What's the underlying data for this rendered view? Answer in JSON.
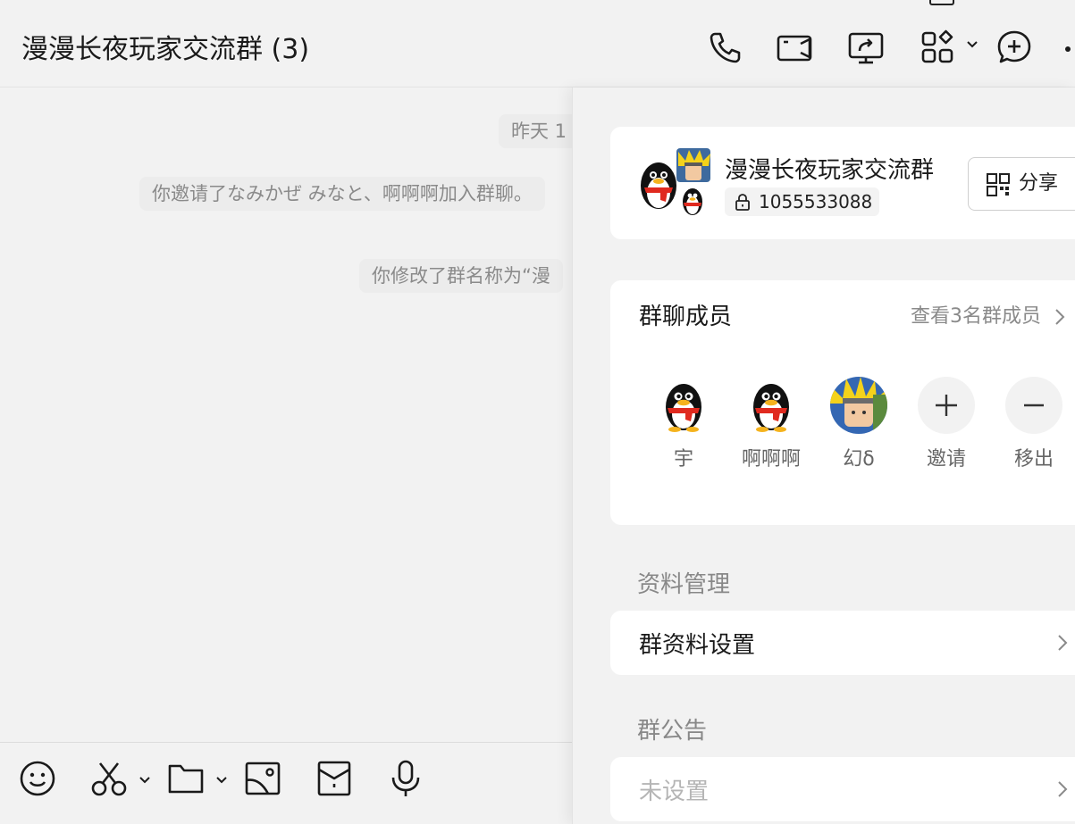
{
  "header": {
    "title": "漫漫长夜玩家交流群 (3)",
    "icons": [
      "phone-icon",
      "video-icon",
      "screen-share-icon",
      "apps-icon",
      "add-chat-icon",
      "more-icon"
    ]
  },
  "chat": {
    "messages": [
      {
        "text": "昨天 1"
      },
      {
        "text": "你邀请了なみかぜ みなと、啊啊啊加入群聊。"
      },
      {
        "text": "你修改了群名称为“漫"
      }
    ]
  },
  "toolbar": {
    "icons": [
      "emoji-icon",
      "scissors-icon",
      "folder-icon",
      "image-icon",
      "red-packet-icon",
      "microphone-icon"
    ]
  },
  "panel": {
    "group": {
      "name": "漫漫长夜玩家交流群",
      "id": "1055533088",
      "share_label": "分享"
    },
    "members": {
      "title": "群聊成员",
      "view_all": "查看3名群成员",
      "list": [
        {
          "name": "宇",
          "avatar": "penguin"
        },
        {
          "name": "啊啊啊",
          "avatar": "penguin"
        },
        {
          "name": "幻δ",
          "avatar": "anime"
        }
      ],
      "invite_label": "邀请",
      "remove_label": "移出"
    },
    "management_label": "资料管理",
    "settings_label": "群资料设置",
    "notice_label": "群公告",
    "notice_value": "未设置"
  }
}
